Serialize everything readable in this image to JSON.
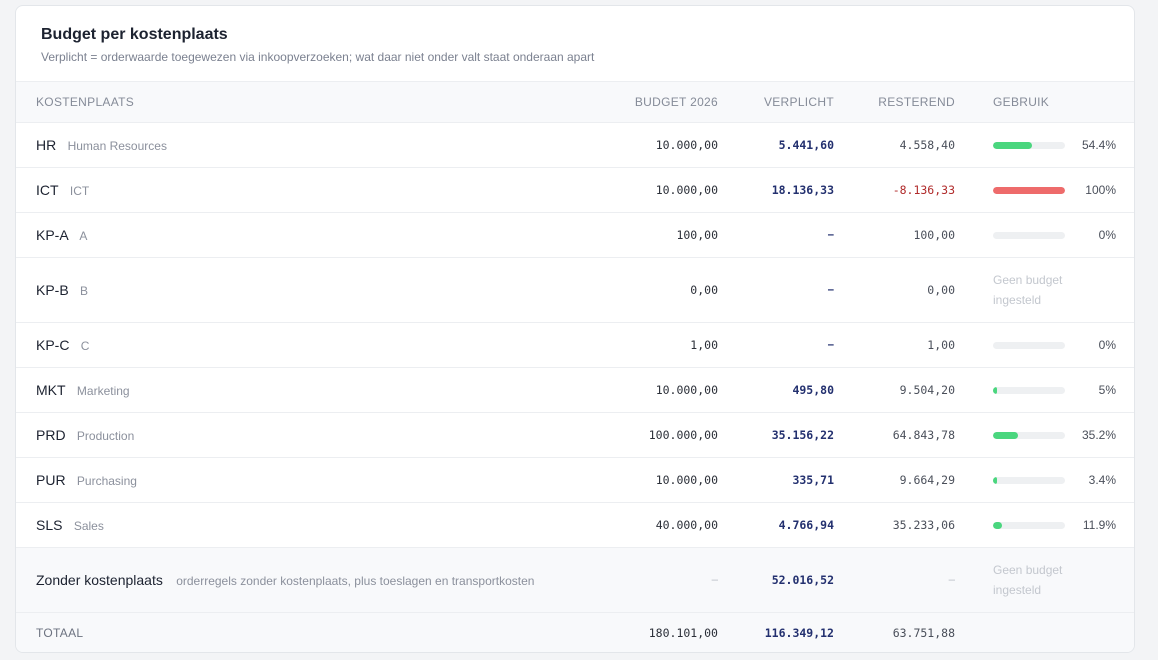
{
  "card": {
    "title": "Budget per kostenplaats",
    "subtitle": "Verplicht = orderwaarde toegewezen via inkoopverzoeken; wat daar niet onder valt staat onderaan apart"
  },
  "columns": {
    "kostenplaats": "KOSTENPLAATS",
    "budget": "BUDGET 2026",
    "verplicht": "VERPLICHT",
    "resterend": "RESTEREND",
    "gebruik": "GEBRUIK"
  },
  "rows": [
    {
      "code": "HR",
      "name": "Human Resources",
      "budget": "10.000,00",
      "committed": "5.441,60",
      "remaining": "4.558,40",
      "usage_pct": 54.4,
      "usage_label": "54.4%"
    },
    {
      "code": "ICT",
      "name": "ICT",
      "budget": "10.000,00",
      "committed": "18.136,33",
      "remaining": "-8.136,33",
      "usage_pct": 100,
      "usage_label": "100%"
    },
    {
      "code": "KP-A",
      "name": "A",
      "budget": "100,00",
      "committed": "–",
      "remaining": "100,00",
      "usage_pct": 0,
      "usage_label": "0%"
    },
    {
      "code": "KP-B",
      "name": "B",
      "budget": "0,00",
      "committed": "–",
      "remaining": "0,00",
      "no_budget_line1": "Geen budget",
      "no_budget_line2": "ingesteld"
    },
    {
      "code": "KP-C",
      "name": "C",
      "budget": "1,00",
      "committed": "–",
      "remaining": "1,00",
      "usage_pct": 0,
      "usage_label": "0%"
    },
    {
      "code": "MKT",
      "name": "Marketing",
      "budget": "10.000,00",
      "committed": "495,80",
      "remaining": "9.504,20",
      "usage_pct": 5,
      "usage_label": "5%"
    },
    {
      "code": "PRD",
      "name": "Production",
      "budget": "100.000,00",
      "committed": "35.156,22",
      "remaining": "64.843,78",
      "usage_pct": 35.2,
      "usage_label": "35.2%"
    },
    {
      "code": "PUR",
      "name": "Purchasing",
      "budget": "10.000,00",
      "committed": "335,71",
      "remaining": "9.664,29",
      "usage_pct": 3.4,
      "usage_label": "3.4%"
    },
    {
      "code": "SLS",
      "name": "Sales",
      "budget": "40.000,00",
      "committed": "4.766,94",
      "remaining": "35.233,06",
      "usage_pct": 11.9,
      "usage_label": "11.9%"
    }
  ],
  "unassigned": {
    "label": "Zonder kostenplaats",
    "description": "orderregels zonder kostenplaats, plus toeslagen en transportkosten",
    "budget": "–",
    "committed": "52.016,52",
    "remaining": "–",
    "no_budget_line1": "Geen budget",
    "no_budget_line2": "ingesteld"
  },
  "total": {
    "label": "TOTAAL",
    "budget": "180.101,00",
    "committed": "116.349,12",
    "remaining": "63.751,88"
  },
  "colors": {
    "bar_ok": "#4ad67e",
    "bar_over": "#ee6b6b",
    "bar_track": "#eef0f2",
    "committed_text": "#23306f",
    "negative_text": "#b02a2a"
  }
}
